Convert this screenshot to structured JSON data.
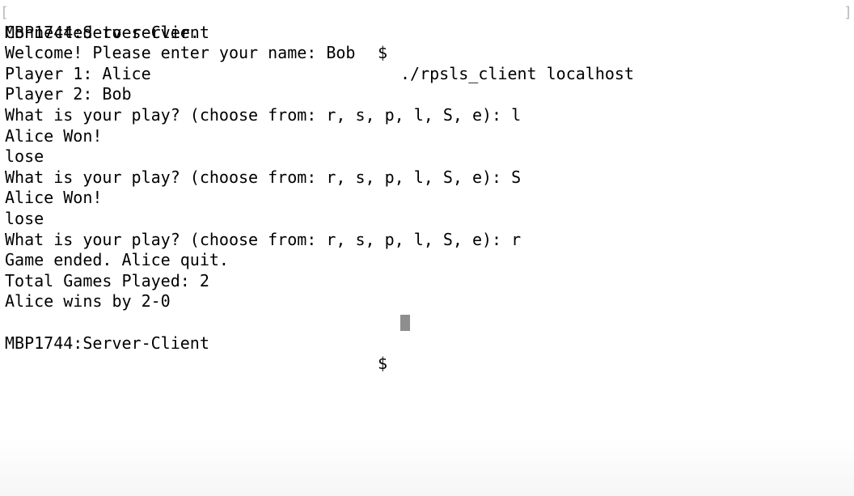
{
  "terminal": {
    "first_prompt": {
      "host": "MBP1744:Server-Client",
      "symbol": "$",
      "command": "./rpsls_client localhost"
    },
    "output_lines": [
      "Connected to server.",
      "Welcome! Please enter your name: Bob",
      "Player 1: Alice",
      "Player 2: Bob",
      "What is your play? (choose from: r, s, p, l, S, e): l",
      "Alice Won!",
      "lose",
      "What is your play? (choose from: r, s, p, l, S, e): S",
      "Alice Won!",
      "lose",
      "What is your play? (choose from: r, s, p, l, S, e): r",
      "Game ended. Alice quit.",
      "Total Games Played: 2",
      "Alice wins by 2-0"
    ],
    "last_prompt": {
      "host": "MBP1744:Server-Client",
      "symbol": "$"
    },
    "colors": {
      "background": "#ffffff",
      "text": "#000000",
      "cursor": "#8e8e8e"
    }
  }
}
